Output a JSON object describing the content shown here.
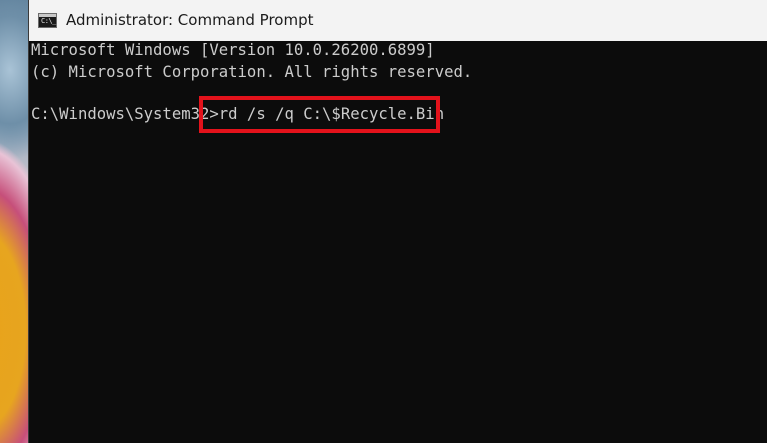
{
  "window": {
    "title": "Administrator: Command Prompt",
    "icon": "command-prompt-icon",
    "icon_glyph": "C:\\_"
  },
  "console": {
    "lines": [
      "Microsoft Windows [Version 10.0.26200.6899]",
      "(c) Microsoft Corporation. All rights reserved."
    ],
    "prompt": "C:\\Windows\\System32>",
    "command": "rd /s /q C:\\$Recycle.Bin"
  },
  "colors": {
    "console_background": "#0c0c0c",
    "console_text": "#cccccc",
    "titlebar_background": "#f3f3f3",
    "highlight": "#e3121b"
  }
}
